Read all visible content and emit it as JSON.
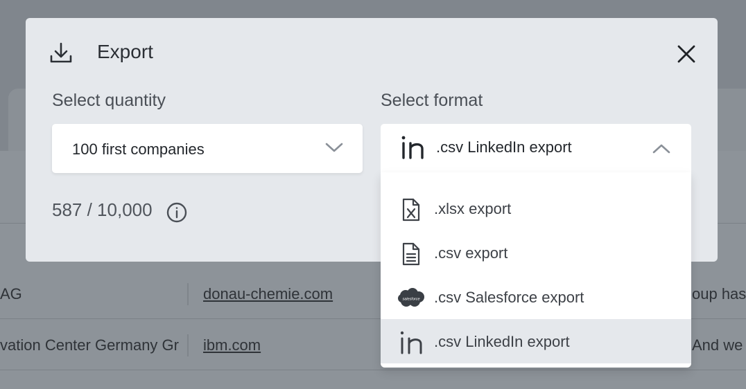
{
  "background": {
    "rows": [
      {
        "company": "AG",
        "domain": "donau-chemie.com",
        "description": "oup has"
      },
      {
        "company": "vation Center Germany Gr",
        "domain": "ibm.com",
        "description": "And we"
      }
    ]
  },
  "modal": {
    "title": "Export",
    "close_icon": "close-icon",
    "quantity": {
      "label": "Select quantity",
      "value": "100 first companies"
    },
    "format": {
      "label": "Select format",
      "value": ".csv LinkedIn export"
    },
    "quota": "587 / 10,000"
  },
  "dropdown": {
    "options": [
      {
        "label": ".xlsx export",
        "icon": "excel-file-icon"
      },
      {
        "label": ".csv export",
        "icon": "document-icon"
      },
      {
        "label": ".csv Salesforce export",
        "icon": "salesforce-icon"
      },
      {
        "label": ".csv LinkedIn export",
        "icon": "linkedin-icon",
        "selected": true
      }
    ]
  },
  "colors": {
    "modal_bg": "#e5e8ec",
    "overlay": "#8d9399",
    "selected_option_bg": "#e5e8ec",
    "salesforce": "#3a3f45"
  }
}
